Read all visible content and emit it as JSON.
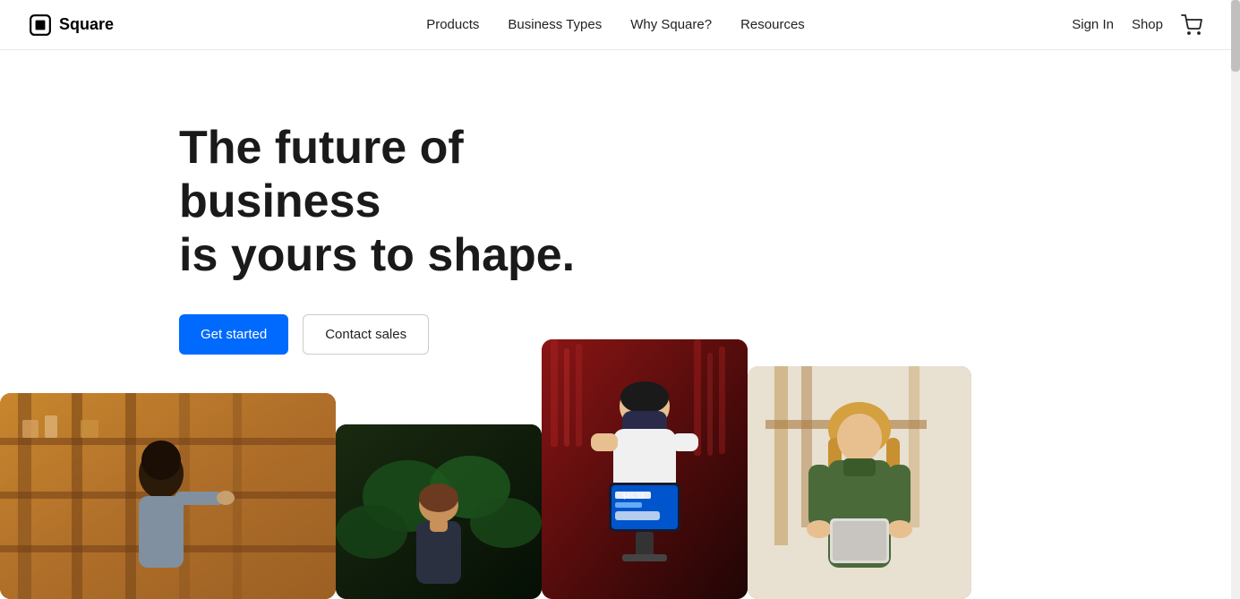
{
  "nav": {
    "logo_text": "Square",
    "links": [
      {
        "label": "Products",
        "id": "products"
      },
      {
        "label": "Business Types",
        "id": "business-types"
      },
      {
        "label": "Why Square?",
        "id": "why-square"
      },
      {
        "label": "Resources",
        "id": "resources"
      }
    ],
    "sign_in": "Sign In",
    "shop": "Shop"
  },
  "hero": {
    "title_line1": "The future of business",
    "title_line2": "is yours to shape.",
    "cta_primary": "Get started",
    "cta_secondary": "Contact sales"
  },
  "images": [
    {
      "id": "img-woman-shelves",
      "alt": "Woman smiling at shelves in workshop"
    },
    {
      "id": "img-man-plants",
      "alt": "Man looking down at plants at night"
    },
    {
      "id": "img-man-tablet",
      "alt": "Man in mask using Square tablet at restaurant"
    },
    {
      "id": "img-woman-workshop",
      "alt": "Woman in green jacket at wooden workshop"
    }
  ]
}
